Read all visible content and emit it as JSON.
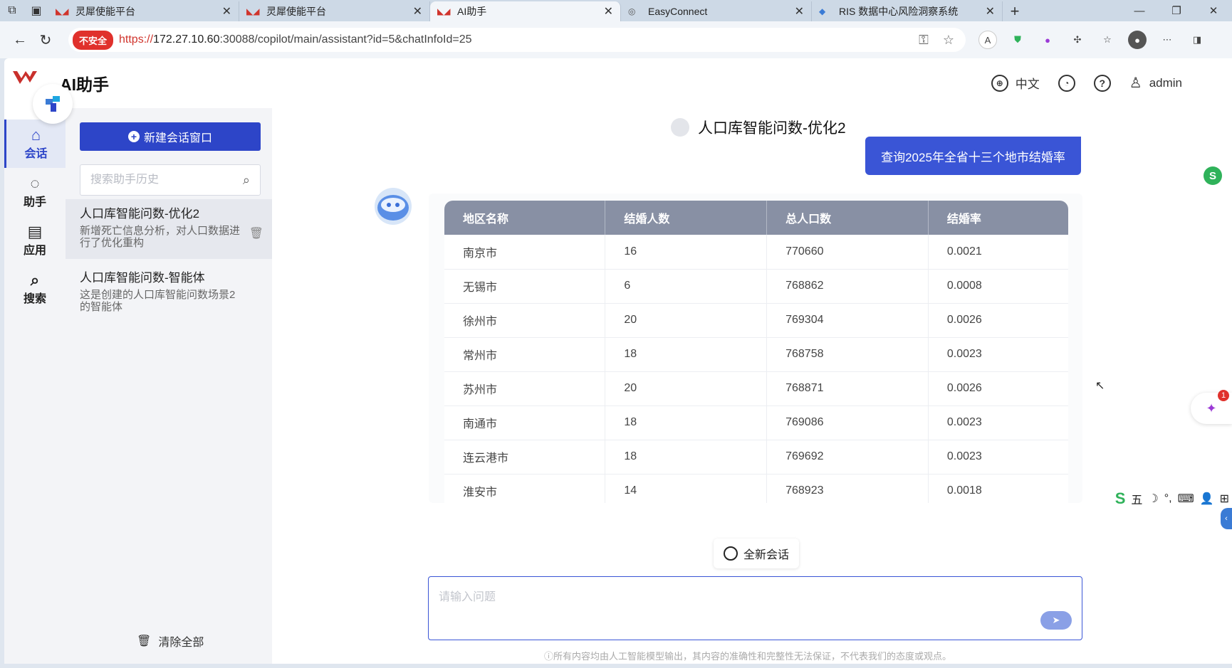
{
  "browser": {
    "tabs": [
      {
        "title": "灵犀使能平台",
        "active": false
      },
      {
        "title": "灵犀使能平台",
        "active": false
      },
      {
        "title": "AI助手",
        "active": true
      },
      {
        "title": "EasyConnect",
        "active": false
      },
      {
        "title": "RIS 数据中心风险洞察系统",
        "active": false
      }
    ],
    "new_tab": "+",
    "security_label": "不安全",
    "url_proto": "https://",
    "url_host": "172.27.10.60",
    "url_rest": ":30088/copilot/main/assistant?id=5&chatInfoId=25"
  },
  "header": {
    "app_title": "AI助手",
    "language": "中文",
    "username": "admin"
  },
  "rail": [
    {
      "label": "会话",
      "icon": "home-icon",
      "active": true
    },
    {
      "label": "助手",
      "icon": "chat-icon",
      "active": false
    },
    {
      "label": "应用",
      "icon": "app-icon",
      "active": false
    },
    {
      "label": "搜索",
      "icon": "search-icon",
      "active": false
    }
  ],
  "sidebar": {
    "new_chat_label": "新建会话窗口",
    "search_placeholder": "搜索助手历史",
    "history": [
      {
        "title": "人口库智能问数-优化2",
        "desc": "新增死亡信息分析，对人口数据进行了优化重构"
      },
      {
        "title": "人口库智能问数-智能体",
        "desc": "这是创建的人口库智能问数场景2的智能体"
      }
    ],
    "clear_all": "清除全部"
  },
  "chat": {
    "title": "人口库智能问数-优化2",
    "user_message": "查询2025年全省十三个地市结婚率",
    "table_headers": [
      "地区名称",
      "结婚人数",
      "总人口数",
      "结婚率"
    ],
    "table_rows": [
      [
        "南京市",
        "16",
        "770660",
        "0.0021"
      ],
      [
        "无锡市",
        "6",
        "768862",
        "0.0008"
      ],
      [
        "徐州市",
        "20",
        "769304",
        "0.0026"
      ],
      [
        "常州市",
        "18",
        "768758",
        "0.0023"
      ],
      [
        "苏州市",
        "20",
        "768871",
        "0.0026"
      ],
      [
        "南通市",
        "18",
        "769086",
        "0.0023"
      ],
      [
        "连云港市",
        "18",
        "769692",
        "0.0023"
      ],
      [
        "淮安市",
        "14",
        "768923",
        "0.0018"
      ]
    ],
    "new_session_label": "全新会话",
    "input_placeholder": "请输入问题",
    "disclaimer": "ⓘ所有内容均由人工智能模型输出，其内容的准确性和完整性无法保证，不代表我们的态度或观点。"
  },
  "floating": {
    "badge_count": "1",
    "ime_labels": [
      "五",
      "☽",
      "°,",
      "⌨",
      "👤",
      "⊞"
    ]
  },
  "colors": {
    "primary": "#2d45c8",
    "user_bubble": "#3a55d6",
    "table_header": "#8890a4"
  }
}
